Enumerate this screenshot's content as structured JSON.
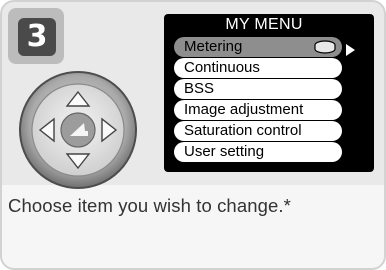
{
  "step": {
    "number": "3"
  },
  "menu": {
    "title": "MY MENU",
    "items": [
      {
        "label": "Metering",
        "selected": true
      },
      {
        "label": "Continuous",
        "selected": false
      },
      {
        "label": "BSS",
        "selected": false
      },
      {
        "label": "Image adjustment",
        "selected": false
      },
      {
        "label": "Saturation control",
        "selected": false
      },
      {
        "label": "User setting",
        "selected": false
      }
    ]
  },
  "caption": "Choose item you wish to change.*",
  "icons": {
    "dpad": "multi-selector-icon",
    "center": "ok-button-icon",
    "lens": "metering-lens-icon",
    "arrow": "arrow-right-icon"
  },
  "colors": {
    "card_background": "#e9e9e9",
    "menu_background": "#000000",
    "selected_item": "#8e8e8e"
  }
}
